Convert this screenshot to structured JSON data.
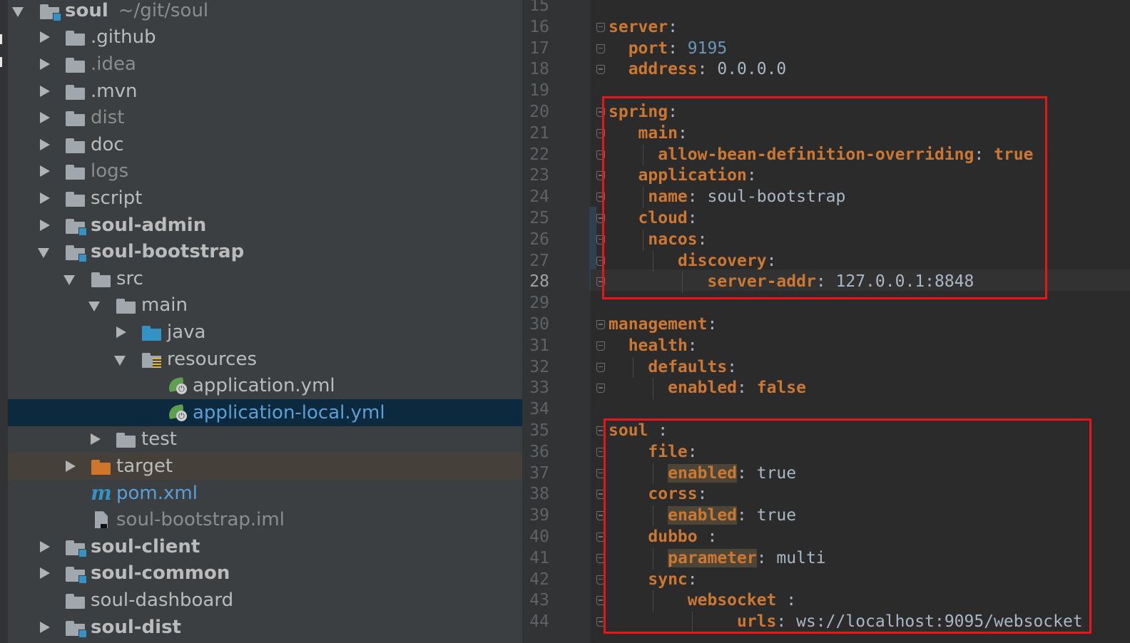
{
  "colors": {
    "tree_bg": "#3c3f41",
    "editor_bg": "#2b2b2b",
    "selection_bg": "#0d293e",
    "yaml_key": "#cc7832",
    "yaml_value": "#a9b7c6",
    "yaml_number": "#6897bb",
    "annotation_box": "#e8161b"
  },
  "project_tree": {
    "root": {
      "name": "soul",
      "path": "~/git/soul"
    },
    "items": [
      {
        "label": "soul",
        "icon": "module-folder-icon"
      },
      {
        "label": ".github",
        "icon": "folder-icon"
      },
      {
        "label": ".idea",
        "icon": "folder-icon"
      },
      {
        "label": ".mvn",
        "icon": "folder-icon"
      },
      {
        "label": "dist",
        "icon": "folder-icon"
      },
      {
        "label": "doc",
        "icon": "folder-icon"
      },
      {
        "label": "logs",
        "icon": "folder-icon"
      },
      {
        "label": "script",
        "icon": "folder-icon"
      },
      {
        "label": "soul-admin",
        "icon": "module-folder-icon"
      },
      {
        "label": "soul-bootstrap",
        "icon": "module-folder-icon"
      },
      {
        "label": "src",
        "icon": "folder-icon"
      },
      {
        "label": "main",
        "icon": "folder-icon"
      },
      {
        "label": "java",
        "icon": "source-folder-icon"
      },
      {
        "label": "resources",
        "icon": "resources-folder-icon"
      },
      {
        "label": "application.yml",
        "icon": "spring-config-icon"
      },
      {
        "label": "application-local.yml",
        "icon": "spring-config-icon",
        "selected": true
      },
      {
        "label": "test",
        "icon": "folder-icon"
      },
      {
        "label": "target",
        "icon": "excluded-folder-icon"
      },
      {
        "label": "pom.xml",
        "icon": "maven-icon"
      },
      {
        "label": "soul-bootstrap.iml",
        "icon": "iml-file-icon"
      },
      {
        "label": "soul-client",
        "icon": "module-folder-icon"
      },
      {
        "label": "soul-common",
        "icon": "module-folder-icon"
      },
      {
        "label": "soul-dashboard",
        "icon": "folder-icon"
      },
      {
        "label": "soul-dist",
        "icon": "module-folder-icon"
      }
    ]
  },
  "editor": {
    "file": "application-local.yml",
    "current_line": "28",
    "lines": [
      {
        "num": "15",
        "tokens": []
      },
      {
        "num": "16",
        "tokens": [
          {
            "t": "server",
            "c": "k"
          },
          {
            "t": ":",
            "c": "p"
          }
        ]
      },
      {
        "num": "17",
        "tokens": [
          {
            "t": "  "
          },
          {
            "t": "port",
            "c": "k"
          },
          {
            "t": ": ",
            "c": "p"
          },
          {
            "t": "9195",
            "c": "n"
          }
        ]
      },
      {
        "num": "18",
        "tokens": [
          {
            "t": "  "
          },
          {
            "t": "address",
            "c": "k"
          },
          {
            "t": ": ",
            "c": "p"
          },
          {
            "t": "0.0.0.0",
            "c": "v"
          }
        ]
      },
      {
        "num": "19",
        "tokens": []
      },
      {
        "num": "20",
        "tokens": [
          {
            "t": "spring",
            "c": "k"
          },
          {
            "t": ":",
            "c": "p"
          }
        ]
      },
      {
        "num": "21",
        "tokens": [
          {
            "t": "   "
          },
          {
            "t": "main",
            "c": "k"
          },
          {
            "t": ":",
            "c": "p"
          }
        ]
      },
      {
        "num": "22",
        "tokens": [
          {
            "t": "     "
          },
          {
            "t": "allow-bean-definition-overriding",
            "c": "k"
          },
          {
            "t": ": ",
            "c": "p"
          },
          {
            "t": "true",
            "c": "b"
          }
        ]
      },
      {
        "num": "23",
        "tokens": [
          {
            "t": "   "
          },
          {
            "t": "application",
            "c": "k"
          },
          {
            "t": ":",
            "c": "p"
          }
        ]
      },
      {
        "num": "24",
        "tokens": [
          {
            "t": "    "
          },
          {
            "t": "name",
            "c": "k"
          },
          {
            "t": ": ",
            "c": "p"
          },
          {
            "t": "soul-bootstrap",
            "c": "v"
          }
        ]
      },
      {
        "num": "25",
        "tokens": [
          {
            "t": "   "
          },
          {
            "t": "cloud",
            "c": "k"
          },
          {
            "t": ":",
            "c": "p"
          }
        ]
      },
      {
        "num": "26",
        "tokens": [
          {
            "t": "    "
          },
          {
            "t": "nacos",
            "c": "k"
          },
          {
            "t": ":",
            "c": "p"
          }
        ]
      },
      {
        "num": "27",
        "tokens": [
          {
            "t": "       "
          },
          {
            "t": "discovery",
            "c": "k"
          },
          {
            "t": ":",
            "c": "p"
          }
        ]
      },
      {
        "num": "28",
        "tokens": [
          {
            "t": "          "
          },
          {
            "t": "server-addr",
            "c": "k"
          },
          {
            "t": ": ",
            "c": "p"
          },
          {
            "t": "127.0.0.1:8848",
            "c": "v"
          }
        ]
      },
      {
        "num": "29",
        "tokens": []
      },
      {
        "num": "30",
        "tokens": [
          {
            "t": "management",
            "c": "k"
          },
          {
            "t": ":",
            "c": "p"
          }
        ]
      },
      {
        "num": "31",
        "tokens": [
          {
            "t": "  "
          },
          {
            "t": "health",
            "c": "k"
          },
          {
            "t": ":",
            "c": "p"
          }
        ]
      },
      {
        "num": "32",
        "tokens": [
          {
            "t": "    "
          },
          {
            "t": "defaults",
            "c": "k"
          },
          {
            "t": ":",
            "c": "p"
          }
        ]
      },
      {
        "num": "33",
        "tokens": [
          {
            "t": "      "
          },
          {
            "t": "enabled",
            "c": "k"
          },
          {
            "t": ": ",
            "c": "p"
          },
          {
            "t": "false",
            "c": "b"
          }
        ]
      },
      {
        "num": "34",
        "tokens": []
      },
      {
        "num": "35",
        "tokens": [
          {
            "t": "soul",
            "c": "k"
          },
          {
            "t": " :",
            "c": "p"
          }
        ]
      },
      {
        "num": "36",
        "tokens": [
          {
            "t": "    "
          },
          {
            "t": "file",
            "c": "k"
          },
          {
            "t": ":",
            "c": "p"
          }
        ]
      },
      {
        "num": "37",
        "tokens": [
          {
            "t": "      "
          },
          {
            "t": "enabled",
            "c": "kh"
          },
          {
            "t": ": ",
            "c": "p"
          },
          {
            "t": "true",
            "c": "v"
          }
        ]
      },
      {
        "num": "38",
        "tokens": [
          {
            "t": "    "
          },
          {
            "t": "corss",
            "c": "k"
          },
          {
            "t": ":",
            "c": "p"
          }
        ]
      },
      {
        "num": "39",
        "tokens": [
          {
            "t": "      "
          },
          {
            "t": "enabled",
            "c": "kh"
          },
          {
            "t": ": ",
            "c": "p"
          },
          {
            "t": "true",
            "c": "v"
          }
        ]
      },
      {
        "num": "40",
        "tokens": [
          {
            "t": "    "
          },
          {
            "t": "dubbo",
            "c": "k"
          },
          {
            "t": " :",
            "c": "p"
          }
        ]
      },
      {
        "num": "41",
        "tokens": [
          {
            "t": "      "
          },
          {
            "t": "parameter",
            "c": "kh"
          },
          {
            "t": ": ",
            "c": "p"
          },
          {
            "t": "multi",
            "c": "v"
          }
        ]
      },
      {
        "num": "42",
        "tokens": [
          {
            "t": "    "
          },
          {
            "t": "sync",
            "c": "k"
          },
          {
            "t": ":",
            "c": "p"
          }
        ]
      },
      {
        "num": "43",
        "tokens": [
          {
            "t": "        "
          },
          {
            "t": "websocket",
            "c": "k"
          },
          {
            "t": " :",
            "c": "p"
          }
        ]
      },
      {
        "num": "44",
        "tokens": [
          {
            "t": "             "
          },
          {
            "t": "urls",
            "c": "k"
          },
          {
            "t": ": ",
            "c": "p"
          },
          {
            "t": "ws://localhost:9095/websocket",
            "c": "v"
          }
        ]
      }
    ]
  }
}
